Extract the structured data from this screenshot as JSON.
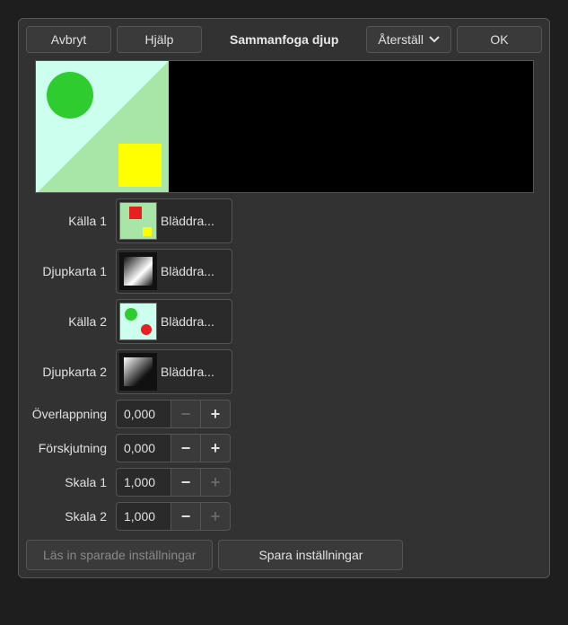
{
  "toolbar": {
    "cancel": "Avbryt",
    "help": "Hjälp",
    "title": "Sammanfoga djup",
    "reset": "Återställ",
    "ok": "OK"
  },
  "rows": {
    "source1": {
      "label": "Källa 1",
      "browse": "Bläddra..."
    },
    "depth1": {
      "label": "Djupkarta 1",
      "browse": "Bläddra..."
    },
    "source2": {
      "label": "Källa 2",
      "browse": "Bläddra..."
    },
    "depth2": {
      "label": "Djupkarta 2",
      "browse": "Bläddra..."
    },
    "overlap": {
      "label": "Överlappning",
      "value": "0,000"
    },
    "offset": {
      "label": "Förskjutning",
      "value": "0,000"
    },
    "scale1": {
      "label": "Skala 1",
      "value": "1,000"
    },
    "scale2": {
      "label": "Skala 2",
      "value": "1,000"
    }
  },
  "buttons": {
    "load": "Läs in sparade inställningar",
    "save": "Spara inställningar"
  }
}
